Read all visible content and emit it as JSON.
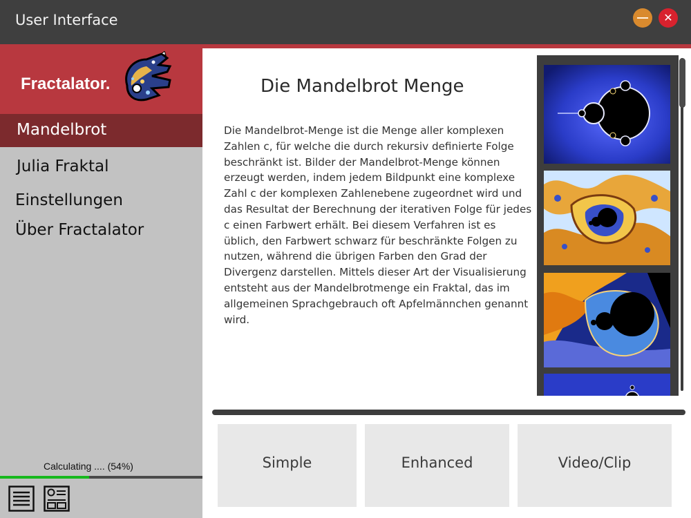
{
  "window": {
    "title": "User Interface",
    "minimize_icon": "minimize-icon",
    "close_icon": "close-icon",
    "close_glyph": "✕"
  },
  "sidebar": {
    "logo_text": "Fractalator.",
    "logo_icon": "crocodile-logo-icon",
    "items": [
      {
        "label": "Mandelbrot",
        "active": true
      },
      {
        "label": "Julia Fraktal",
        "active": false
      },
      {
        "label": "Einstellungen",
        "active": false
      },
      {
        "label": "Über Fractalator",
        "active": false
      }
    ],
    "status": "Calculating .... (54%)",
    "progress": 0.44,
    "tool_icons": [
      "document-list-icon",
      "profile-card-icon"
    ]
  },
  "main": {
    "heading": "Die Mandelbrot Menge",
    "description": "Die Mandelbrot-Menge ist die Menge aller komplexen Zahlen c, für welche die durch rekursiv definierte Folge beschränkt ist. Bilder der Mandelbrot-Menge können erzeugt werden, indem jedem Bildpunkt eine komplexe Zahl c der komplexen Zahlenebene zugeordnet wird und das Resultat der Berechnung der iterativen Folge für jedes c einen Farbwert erhält. Bei diesem Verfahren ist es üblich, den Farbwert schwarz für beschränkte Folgen zu nutzen, während die übrigen Farben den Grad der Divergenz darstellen. Mittels dieser Art der Visualisierung entsteht aus der Mandelbrotmenge ein Fraktal, das im allgemeinen Sprachgebrauch oft Apfelmännchen genannt wird.",
    "gallery": [
      "mandelbrot-blue-thumbnail",
      "mandelbrot-gold-zoom-thumbnail",
      "mandelbrot-deep-zoom-thumbnail",
      "mandelbrot-blue-partial-thumbnail"
    ],
    "modes": [
      "Simple",
      "Enhanced",
      "Video/Clip"
    ]
  },
  "colors": {
    "titlebar": "#3f3f3f",
    "accent": "#b8383f",
    "active_nav": "#7c2a2d",
    "sidebar": "#c2c2c2",
    "progress": "#17b81d"
  }
}
